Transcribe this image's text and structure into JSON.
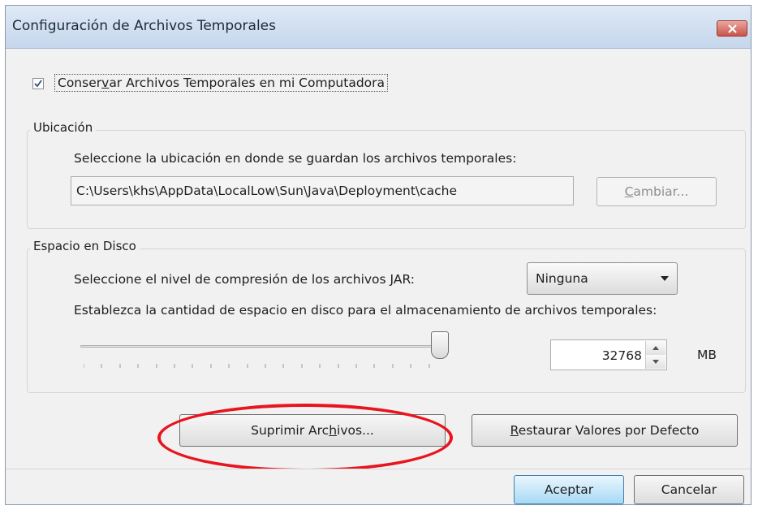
{
  "dialog": {
    "title": "Configuración de Archivos Temporales"
  },
  "keep_temp": {
    "checked": true,
    "label_pre": "Conser",
    "label_accel": "v",
    "label_post": "ar Archivos Temporales en mi Computadora"
  },
  "location": {
    "group_title": "Ubicación",
    "instruction": "Seleccione la ubicación en donde se guardan los archivos temporales:",
    "path": "C:\\Users\\khs\\AppData\\LocalLow\\Sun\\Java\\Deployment\\cache",
    "change_accel": "C",
    "change_rest": "ambiar...",
    "change_enabled": false
  },
  "disk_space": {
    "group_title": "Espacio en Disco",
    "compression_label": "Seleccione el nivel de compresión de los archivos JAR:",
    "compression_value": "Ninguna",
    "space_label": "Establezca la cantidad de espacio en disco para el almacenamiento de archivos temporales:",
    "slider_level": 1.0,
    "space_value": "32768",
    "space_unit": "MB"
  },
  "actions": {
    "delete_pre": "Suprimir Arc",
    "delete_accel": "h",
    "delete_post": "ivos...",
    "restore_accel": "R",
    "restore_rest": "estaurar Valores por Defecto"
  },
  "footer": {
    "ok_label": "Aceptar",
    "cancel_label": "Cancelar"
  },
  "colors": {
    "highlight": "#e8141e",
    "titlebar": "#c6d6ec",
    "primary_button": "#a7d9f5"
  },
  "icons": [
    "close-icon",
    "checkmark-icon",
    "dropdown-arrow-icon",
    "spin-up-icon",
    "spin-down-icon"
  ]
}
